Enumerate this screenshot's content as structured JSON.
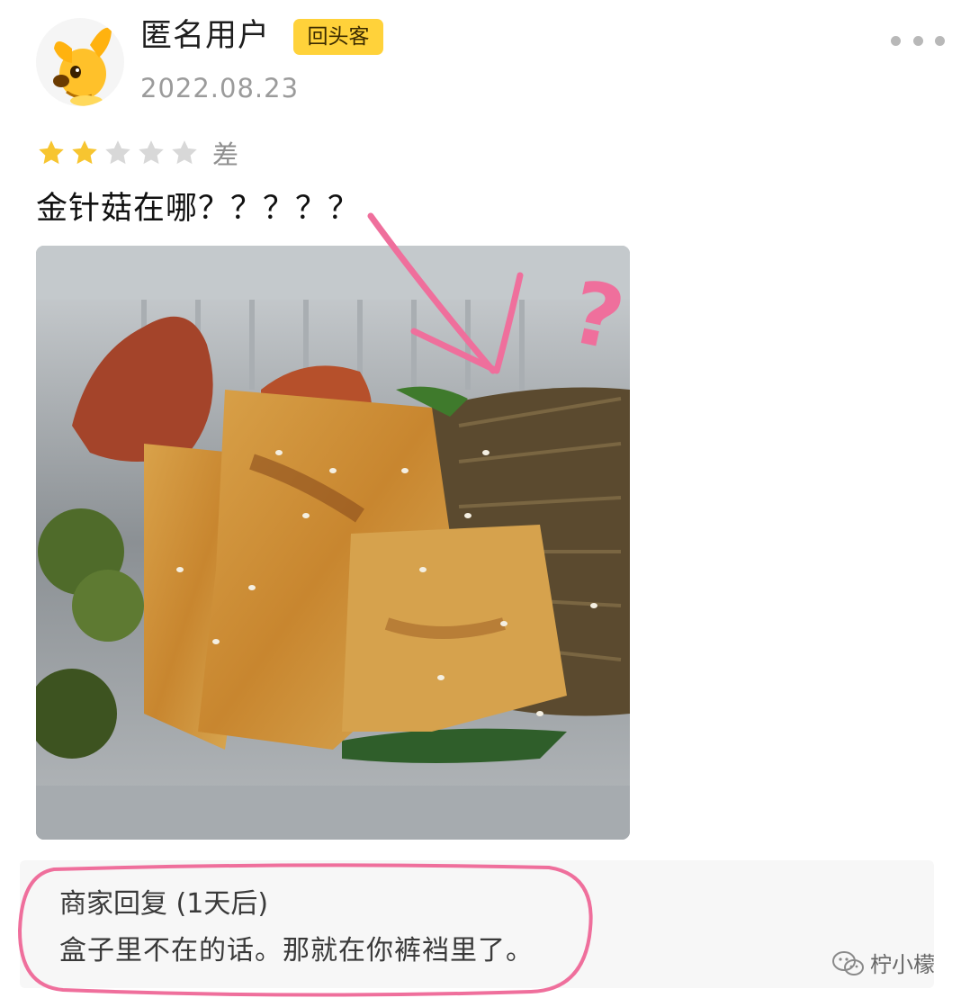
{
  "review_card": {
    "user": {
      "name": "匿名用户",
      "badge": "回头客",
      "date": "2022.08.23",
      "avatar_icon": "yellow-dog-icon"
    },
    "rating": {
      "stars_filled": 2,
      "stars_total": 5,
      "label": "差",
      "filled_color": "#f7c530",
      "empty_color": "#d8d8d8"
    },
    "review_text": "金针菇在哪？？？？？",
    "photo": {
      "annotation_mark": "?"
    },
    "merchant_reply": {
      "title": "商家回复 (1天后)",
      "text": "盒子里不在的话。那就在你裤裆里了。"
    },
    "more_menu_icon": "more-dots-icon"
  },
  "watermark": {
    "icon": "wechat-icon",
    "text": "柠小檬"
  },
  "colors": {
    "badge": "#ffd23a",
    "annotation_pink": "#ef6f9c"
  }
}
